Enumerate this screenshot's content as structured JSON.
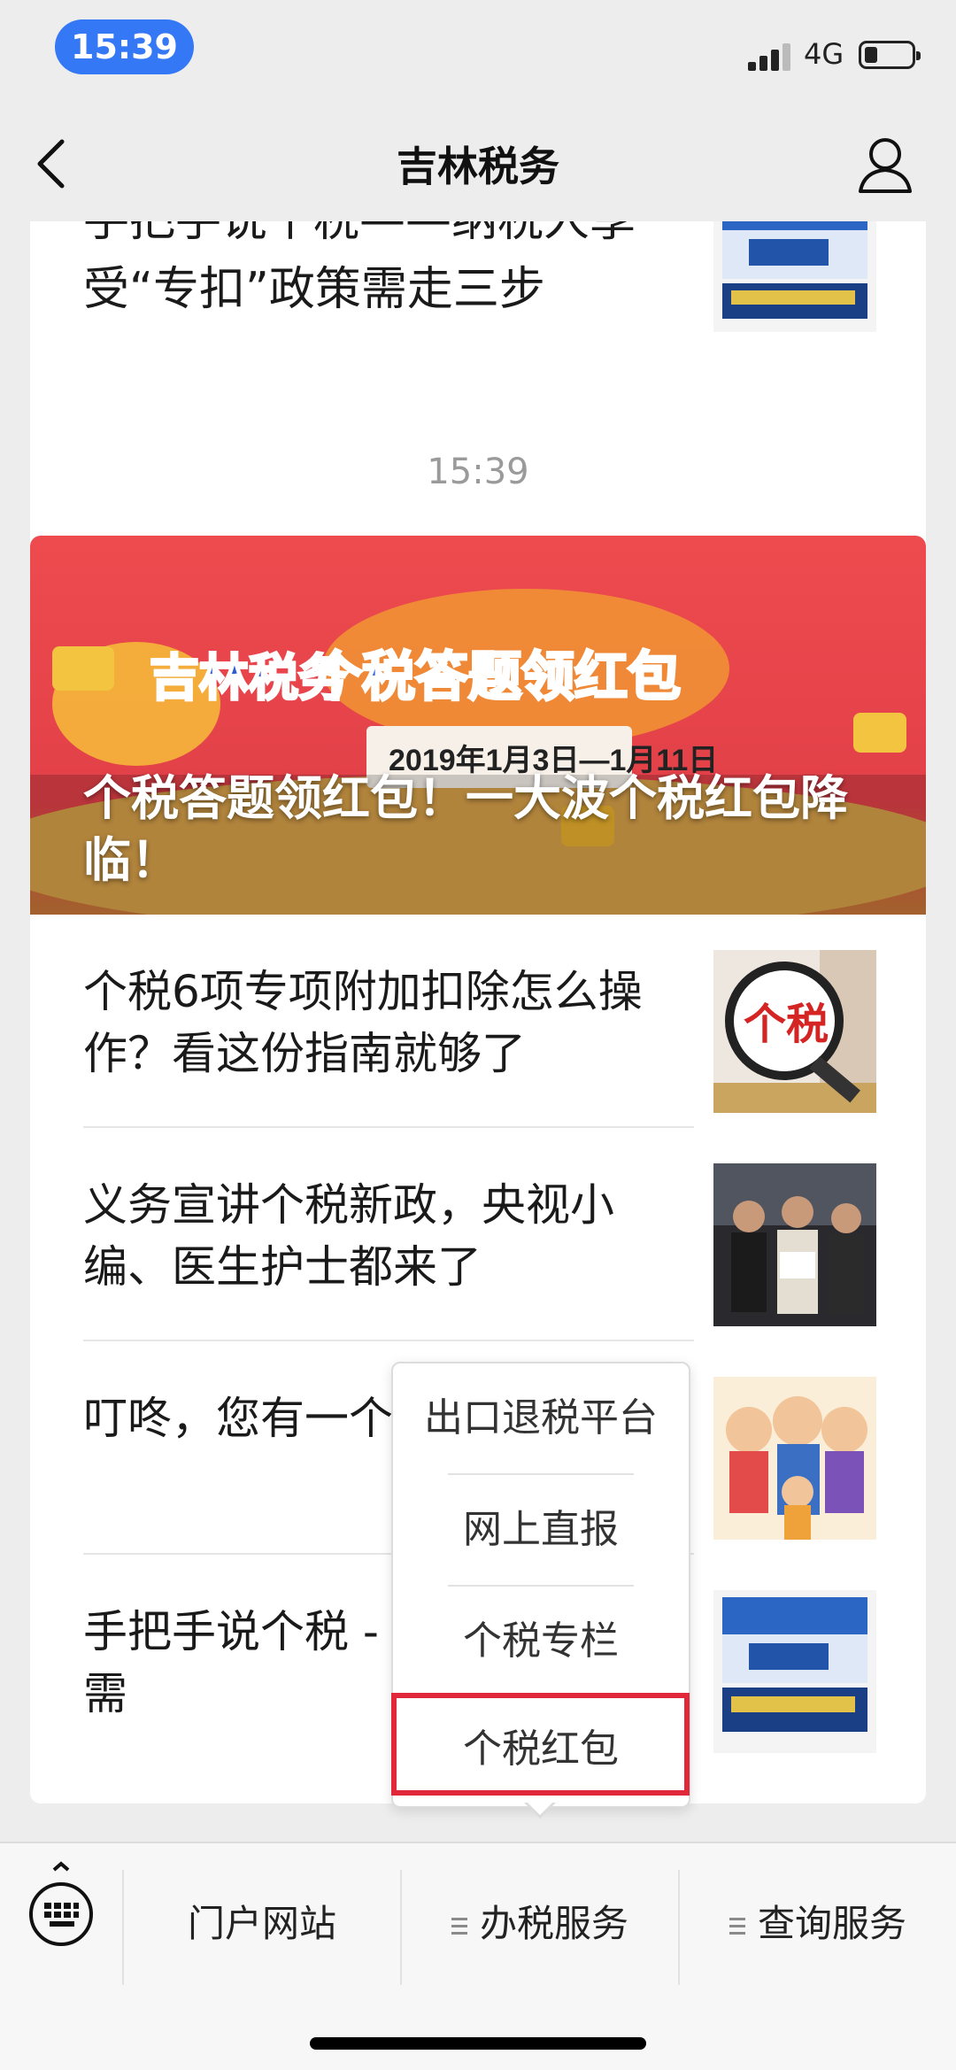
{
  "status": {
    "time": "15:39",
    "network": "4G",
    "battery_percent": 25
  },
  "nav": {
    "title": "吉林税务"
  },
  "top_card": {
    "title": "手把手说个税——纳税人享受“专扣”政策需走三步"
  },
  "timestamp": "15:39",
  "banner": {
    "title": "个税答题领红包！一大波个税红包降临！",
    "image_text": {
      "brand": "吉林税务",
      "headline": "个税答题领红包",
      "dates": "2019年1月3日—1月11日"
    }
  },
  "articles": [
    {
      "title": "个税6项专项附加扣除怎么操作？看这份指南就够了",
      "thumb_text": "个税"
    },
    {
      "title": "义务宣讲个税新政，央视小编、医生护士都来了"
    },
    {
      "title": "叮咚，您有一个签收"
    },
    {
      "title": "手把手说个税 - 受“专扣”政策需"
    }
  ],
  "popup_menu": {
    "items": [
      "出口退税平台",
      "网上直报",
      "个税专栏",
      "个税红包"
    ],
    "highlighted": "个税红包"
  },
  "bottom_menu": {
    "tabs": [
      "门户网站",
      "办税服务",
      "查询服务"
    ]
  },
  "colors": {
    "accent_blue": "#3478f6",
    "highlight_red": "#e0283a",
    "banner_red": "#e8474c"
  }
}
